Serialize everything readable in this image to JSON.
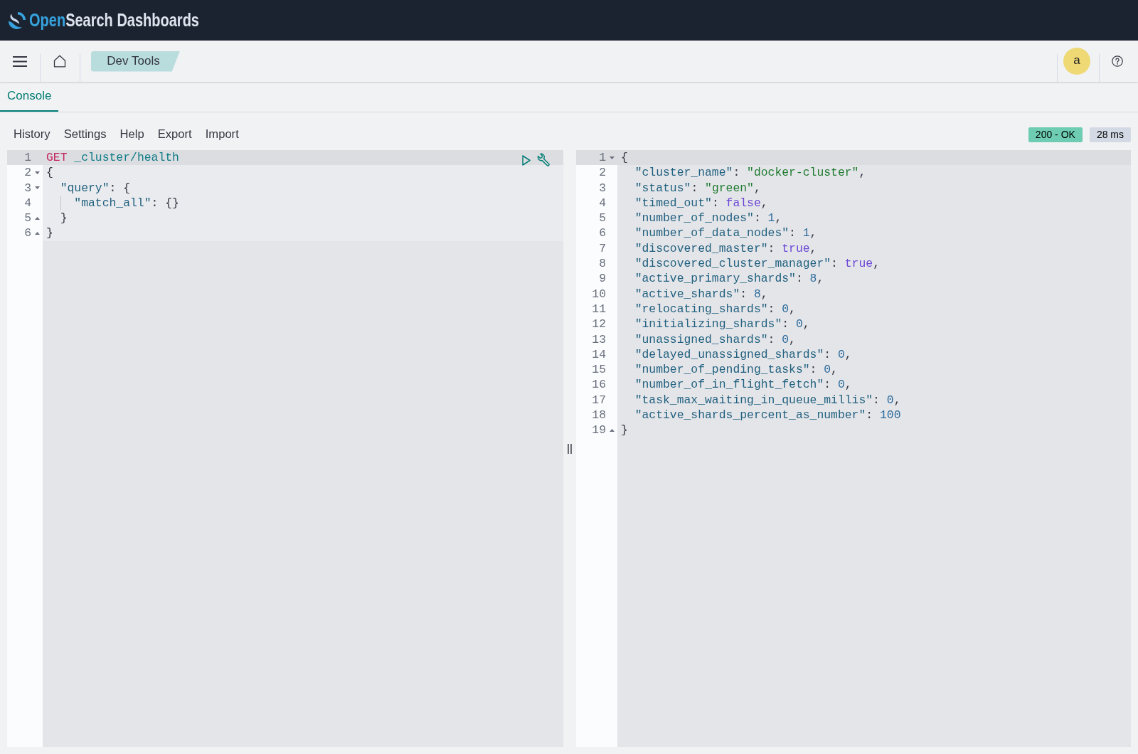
{
  "header": {
    "brand": {
      "accent": "Open",
      "rest": "Search Dashboards"
    }
  },
  "navbar": {
    "breadcrumb": "Dev Tools",
    "avatar": "a"
  },
  "tabs": [
    {
      "label": "Console",
      "selected": true
    }
  ],
  "toolbar": {
    "menu": [
      "History",
      "Settings",
      "Help",
      "Export",
      "Import"
    ],
    "status": "200 - OK",
    "time": "28 ms"
  },
  "request_editor": {
    "lines": [
      {
        "number": "1",
        "fold_start": false,
        "fold_end": false,
        "active": true,
        "tokens": [
          {
            "kind": "method",
            "text": "GET"
          },
          {
            "kind": "url",
            "text": " _cluster/health"
          }
        ]
      },
      {
        "number": "2",
        "fold_start": true,
        "fold_end": false,
        "active": false,
        "tokens": [
          {
            "kind": "punct",
            "text": "{"
          }
        ]
      },
      {
        "number": "3",
        "fold_start": true,
        "fold_end": false,
        "active": false,
        "tokens": [
          {
            "kind": "key",
            "text": "  \"query\""
          },
          {
            "kind": "punct",
            "text": ": {"
          }
        ]
      },
      {
        "number": "4",
        "fold_start": false,
        "fold_end": false,
        "active": false,
        "tokens": [
          {
            "kind": "key",
            "text": "    \"match_all\""
          },
          {
            "kind": "punct",
            "text": ": {}"
          }
        ]
      },
      {
        "number": "5",
        "fold_start": false,
        "fold_end": true,
        "active": false,
        "tokens": [
          {
            "kind": "punct",
            "text": "  }"
          }
        ]
      },
      {
        "number": "6",
        "fold_start": false,
        "fold_end": true,
        "active": false,
        "tokens": [
          {
            "kind": "punct",
            "text": "}"
          }
        ]
      }
    ]
  },
  "response_editor": {
    "lines": [
      {
        "number": "1",
        "fold_start": true,
        "fold_end": false,
        "active": true,
        "tokens": [
          {
            "kind": "punct",
            "text": "{"
          }
        ]
      },
      {
        "number": "2",
        "fold_start": false,
        "fold_end": false,
        "active": false,
        "tokens": [
          {
            "kind": "key",
            "text": "  \"cluster_name\""
          },
          {
            "kind": "punct",
            "text": ": "
          },
          {
            "kind": "string",
            "text": "\"docker-cluster\""
          },
          {
            "kind": "punct",
            "text": ","
          }
        ]
      },
      {
        "number": "3",
        "fold_start": false,
        "fold_end": false,
        "active": false,
        "tokens": [
          {
            "kind": "key",
            "text": "  \"status\""
          },
          {
            "kind": "punct",
            "text": ": "
          },
          {
            "kind": "string",
            "text": "\"green\""
          },
          {
            "kind": "punct",
            "text": ","
          }
        ]
      },
      {
        "number": "4",
        "fold_start": false,
        "fold_end": false,
        "active": false,
        "tokens": [
          {
            "kind": "key",
            "text": "  \"timed_out\""
          },
          {
            "kind": "punct",
            "text": ": "
          },
          {
            "kind": "boolean",
            "text": "false"
          },
          {
            "kind": "punct",
            "text": ","
          }
        ]
      },
      {
        "number": "5",
        "fold_start": false,
        "fold_end": false,
        "active": false,
        "tokens": [
          {
            "kind": "key",
            "text": "  \"number_of_nodes\""
          },
          {
            "kind": "punct",
            "text": ": "
          },
          {
            "kind": "number",
            "text": "1"
          },
          {
            "kind": "punct",
            "text": ","
          }
        ]
      },
      {
        "number": "6",
        "fold_start": false,
        "fold_end": false,
        "active": false,
        "tokens": [
          {
            "kind": "key",
            "text": "  \"number_of_data_nodes\""
          },
          {
            "kind": "punct",
            "text": ": "
          },
          {
            "kind": "number",
            "text": "1"
          },
          {
            "kind": "punct",
            "text": ","
          }
        ]
      },
      {
        "number": "7",
        "fold_start": false,
        "fold_end": false,
        "active": false,
        "tokens": [
          {
            "kind": "key",
            "text": "  \"discovered_master\""
          },
          {
            "kind": "punct",
            "text": ": "
          },
          {
            "kind": "boolean",
            "text": "true"
          },
          {
            "kind": "punct",
            "text": ","
          }
        ]
      },
      {
        "number": "8",
        "fold_start": false,
        "fold_end": false,
        "active": false,
        "tokens": [
          {
            "kind": "key",
            "text": "  \"discovered_cluster_manager\""
          },
          {
            "kind": "punct",
            "text": ": "
          },
          {
            "kind": "boolean",
            "text": "true"
          },
          {
            "kind": "punct",
            "text": ","
          }
        ]
      },
      {
        "number": "9",
        "fold_start": false,
        "fold_end": false,
        "active": false,
        "tokens": [
          {
            "kind": "key",
            "text": "  \"active_primary_shards\""
          },
          {
            "kind": "punct",
            "text": ": "
          },
          {
            "kind": "number",
            "text": "8"
          },
          {
            "kind": "punct",
            "text": ","
          }
        ]
      },
      {
        "number": "10",
        "fold_start": false,
        "fold_end": false,
        "active": false,
        "tokens": [
          {
            "kind": "key",
            "text": "  \"active_shards\""
          },
          {
            "kind": "punct",
            "text": ": "
          },
          {
            "kind": "number",
            "text": "8"
          },
          {
            "kind": "punct",
            "text": ","
          }
        ]
      },
      {
        "number": "11",
        "fold_start": false,
        "fold_end": false,
        "active": false,
        "tokens": [
          {
            "kind": "key",
            "text": "  \"relocating_shards\""
          },
          {
            "kind": "punct",
            "text": ": "
          },
          {
            "kind": "number",
            "text": "0"
          },
          {
            "kind": "punct",
            "text": ","
          }
        ]
      },
      {
        "number": "12",
        "fold_start": false,
        "fold_end": false,
        "active": false,
        "tokens": [
          {
            "kind": "key",
            "text": "  \"initializing_shards\""
          },
          {
            "kind": "punct",
            "text": ": "
          },
          {
            "kind": "number",
            "text": "0"
          },
          {
            "kind": "punct",
            "text": ","
          }
        ]
      },
      {
        "number": "13",
        "fold_start": false,
        "fold_end": false,
        "active": false,
        "tokens": [
          {
            "kind": "key",
            "text": "  \"unassigned_shards\""
          },
          {
            "kind": "punct",
            "text": ": "
          },
          {
            "kind": "number",
            "text": "0"
          },
          {
            "kind": "punct",
            "text": ","
          }
        ]
      },
      {
        "number": "14",
        "fold_start": false,
        "fold_end": false,
        "active": false,
        "tokens": [
          {
            "kind": "key",
            "text": "  \"delayed_unassigned_shards\""
          },
          {
            "kind": "punct",
            "text": ": "
          },
          {
            "kind": "number",
            "text": "0"
          },
          {
            "kind": "punct",
            "text": ","
          }
        ]
      },
      {
        "number": "15",
        "fold_start": false,
        "fold_end": false,
        "active": false,
        "tokens": [
          {
            "kind": "key",
            "text": "  \"number_of_pending_tasks\""
          },
          {
            "kind": "punct",
            "text": ": "
          },
          {
            "kind": "number",
            "text": "0"
          },
          {
            "kind": "punct",
            "text": ","
          }
        ]
      },
      {
        "number": "16",
        "fold_start": false,
        "fold_end": false,
        "active": false,
        "tokens": [
          {
            "kind": "key",
            "text": "  \"number_of_in_flight_fetch\""
          },
          {
            "kind": "punct",
            "text": ": "
          },
          {
            "kind": "number",
            "text": "0"
          },
          {
            "kind": "punct",
            "text": ","
          }
        ]
      },
      {
        "number": "17",
        "fold_start": false,
        "fold_end": false,
        "active": false,
        "tokens": [
          {
            "kind": "key",
            "text": "  \"task_max_waiting_in_queue_millis\""
          },
          {
            "kind": "punct",
            "text": ": "
          },
          {
            "kind": "number",
            "text": "0"
          },
          {
            "kind": "punct",
            "text": ","
          }
        ]
      },
      {
        "number": "18",
        "fold_start": false,
        "fold_end": false,
        "active": false,
        "tokens": [
          {
            "kind": "key",
            "text": "  \"active_shards_percent_as_number\""
          },
          {
            "kind": "punct",
            "text": ": "
          },
          {
            "kind": "number",
            "text": "100"
          }
        ]
      },
      {
        "number": "19",
        "fold_start": false,
        "fold_end": true,
        "active": false,
        "tokens": [
          {
            "kind": "punct",
            "text": "}"
          }
        ]
      }
    ]
  }
}
